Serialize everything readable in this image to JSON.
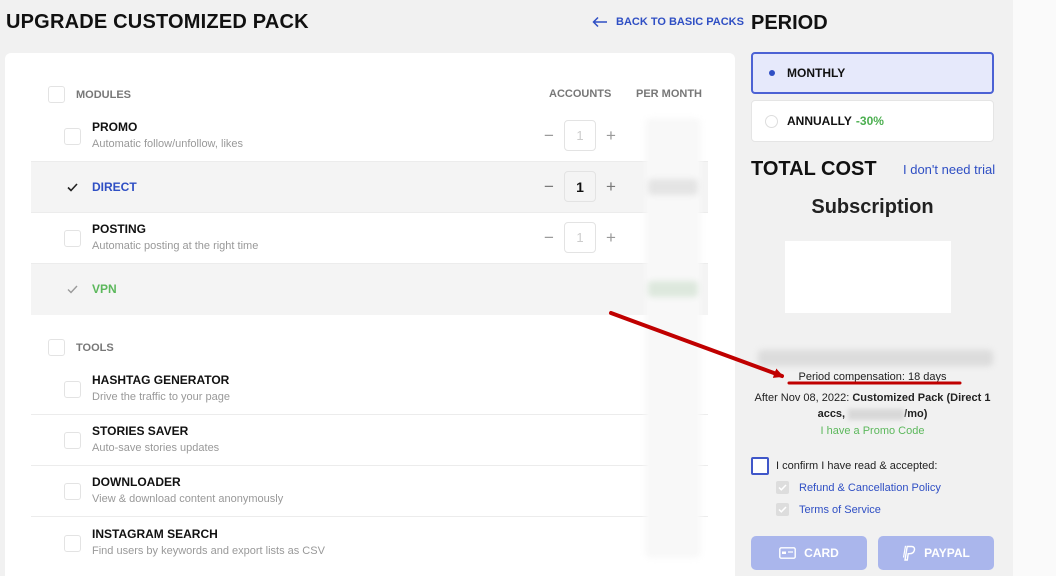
{
  "header": {
    "title": "UPGRADE CUSTOMIZED PACK",
    "back_label": "BACK TO BASIC PACKS"
  },
  "modules": {
    "group_label": "MODULES",
    "col_accounts": "ACCOUNTS",
    "col_per_month": "PER MONTH",
    "items": [
      {
        "name": "PROMO",
        "desc": "Automatic follow/unfollow, likes",
        "checked": false,
        "accounts": "1"
      },
      {
        "name": "DIRECT",
        "desc": "",
        "checked": true,
        "accounts": "1"
      },
      {
        "name": "POSTING",
        "desc": "Automatic posting at the right time",
        "checked": false,
        "accounts": "1"
      },
      {
        "name": "VPN",
        "desc": "",
        "checked": true
      }
    ]
  },
  "tools": {
    "group_label": "TOOLS",
    "items": [
      {
        "name": "HASHTAG GENERATOR",
        "desc": "Drive the traffic to your page"
      },
      {
        "name": "STORIES SAVER",
        "desc": "Auto-save stories updates"
      },
      {
        "name": "DOWNLOADER",
        "desc": "View & download content anonymously"
      },
      {
        "name": "INSTAGRAM SEARCH",
        "desc": "Find users by keywords and export lists as CSV"
      }
    ]
  },
  "stepper": {
    "minus": "−",
    "plus": "+"
  },
  "period": {
    "title": "PERIOD",
    "monthly": "MONTHLY",
    "annually": "ANNUALLY",
    "annual_discount": "-30%",
    "selected": "monthly"
  },
  "summary": {
    "total_title": "TOTAL COST",
    "no_trial": "I don't need trial",
    "subscription": "Subscription",
    "compensation": "Period compensation: 18 days",
    "after_prefix": "After Nov 08, 2022: ",
    "after_pack": "Customized Pack (Direct 1 accs, ",
    "after_suffix": "/mo)",
    "promo": "I have a Promo Code"
  },
  "legal": {
    "confirm": "I confirm I have read & accepted:",
    "refund": "Refund & Cancellation Policy",
    "terms": "Terms of Service"
  },
  "payment": {
    "card": "CARD",
    "paypal": "PAYPAL"
  },
  "colors": {
    "accent": "#2f4fc4",
    "green": "#5cb85c",
    "annotation": "#c00000"
  }
}
